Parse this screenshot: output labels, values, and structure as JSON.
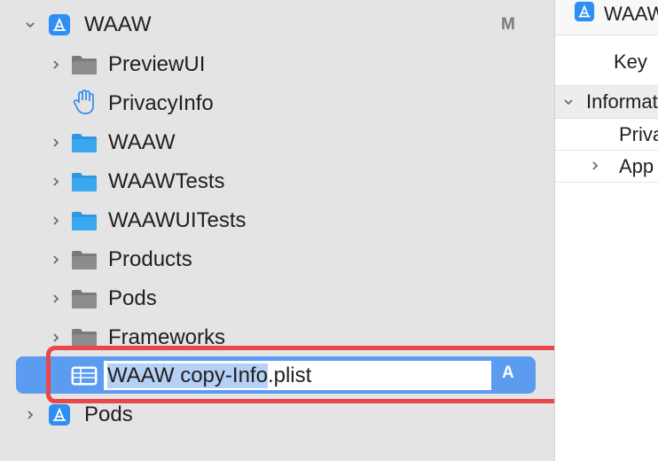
{
  "navigator": {
    "project": {
      "label": "WAAW",
      "badge": "M",
      "icon": "app-store-icon"
    },
    "items": [
      {
        "label": "PreviewUI",
        "icon": "folder-gray-icon"
      },
      {
        "label": "PrivacyInfo",
        "icon": "hand-icon"
      },
      {
        "label": "WAAW",
        "icon": "folder-blue-icon"
      },
      {
        "label": "WAAWTests",
        "icon": "folder-blue-icon"
      },
      {
        "label": "WAAWUITests",
        "icon": "folder-blue-icon"
      },
      {
        "label": "Products",
        "icon": "folder-gray-icon"
      },
      {
        "label": "Pods",
        "icon": "folder-gray-icon"
      },
      {
        "label": "Frameworks",
        "icon": "folder-gray-icon"
      }
    ],
    "selected": {
      "name_selected": "WAAW copy-Info",
      "name_rest": ".plist",
      "badge": "A",
      "icon": "plist-table-icon"
    },
    "pods_project": {
      "label": "Pods",
      "icon": "app-store-icon"
    }
  },
  "editor": {
    "title": "WAAW",
    "key_header": "Key",
    "group_label": "Informat",
    "row1": "Priva",
    "row2": "App"
  },
  "colors": {
    "accent": "#5b9bf0",
    "folder_blue": "#3aa8ef",
    "folder_gray": "#7a7a7a",
    "highlight": "#e8474b"
  }
}
